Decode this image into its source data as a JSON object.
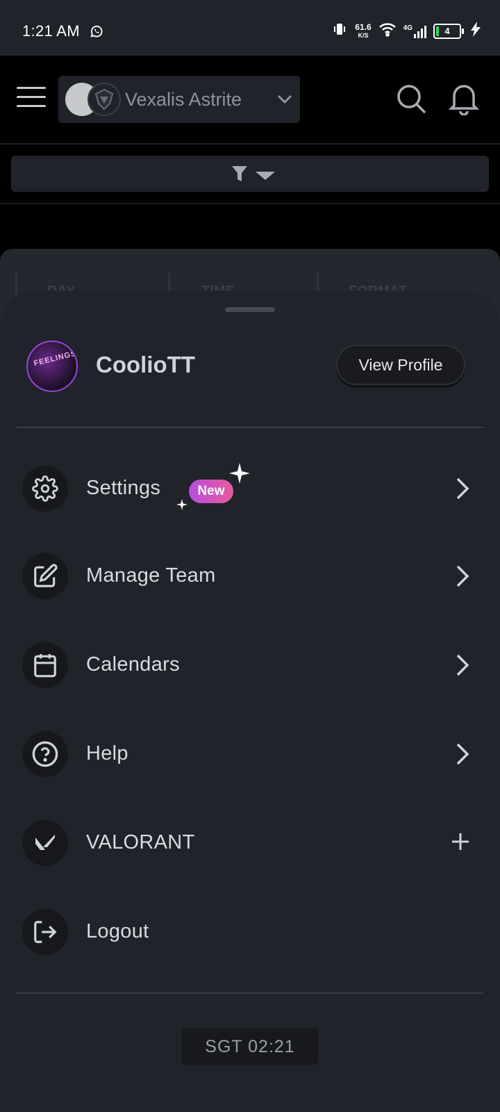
{
  "status_bar": {
    "time": "1:21 AM",
    "net_speed": "61.6",
    "net_unit": "K/S",
    "network": "4G",
    "battery": "4",
    "battery_color": "#3ad35a"
  },
  "header": {
    "team_name": "Vexalis Astrite",
    "icons": [
      "menu-icon",
      "search-icon",
      "bell-icon",
      "chevron-down-icon",
      "filter-icon"
    ]
  },
  "background_columns": [
    "DAY",
    "TIME",
    "FORMAT"
  ],
  "profile": {
    "username": "CoolioTT",
    "avatar_text": "FEELINGS",
    "view_profile_label": "View Profile"
  },
  "menu": {
    "items": [
      {
        "label": "Settings",
        "icon": "gear-icon",
        "badge": "New",
        "action": "arrow"
      },
      {
        "label": "Manage Team",
        "icon": "edit-icon",
        "action": "arrow"
      },
      {
        "label": "Calendars",
        "icon": "calendar-icon",
        "action": "arrow"
      },
      {
        "label": "Help",
        "icon": "help-icon",
        "action": "arrow"
      },
      {
        "label": "VALORANT",
        "icon": "valorant-icon",
        "action": "plus"
      },
      {
        "label": "Logout",
        "icon": "logout-icon",
        "action": "none"
      }
    ]
  },
  "footer": {
    "timezone": "SGT  02:21"
  },
  "colors": {
    "sheet_bg": "#202329",
    "accent_badge": "#c84fcf",
    "avatar_border": "#9b45d8"
  }
}
